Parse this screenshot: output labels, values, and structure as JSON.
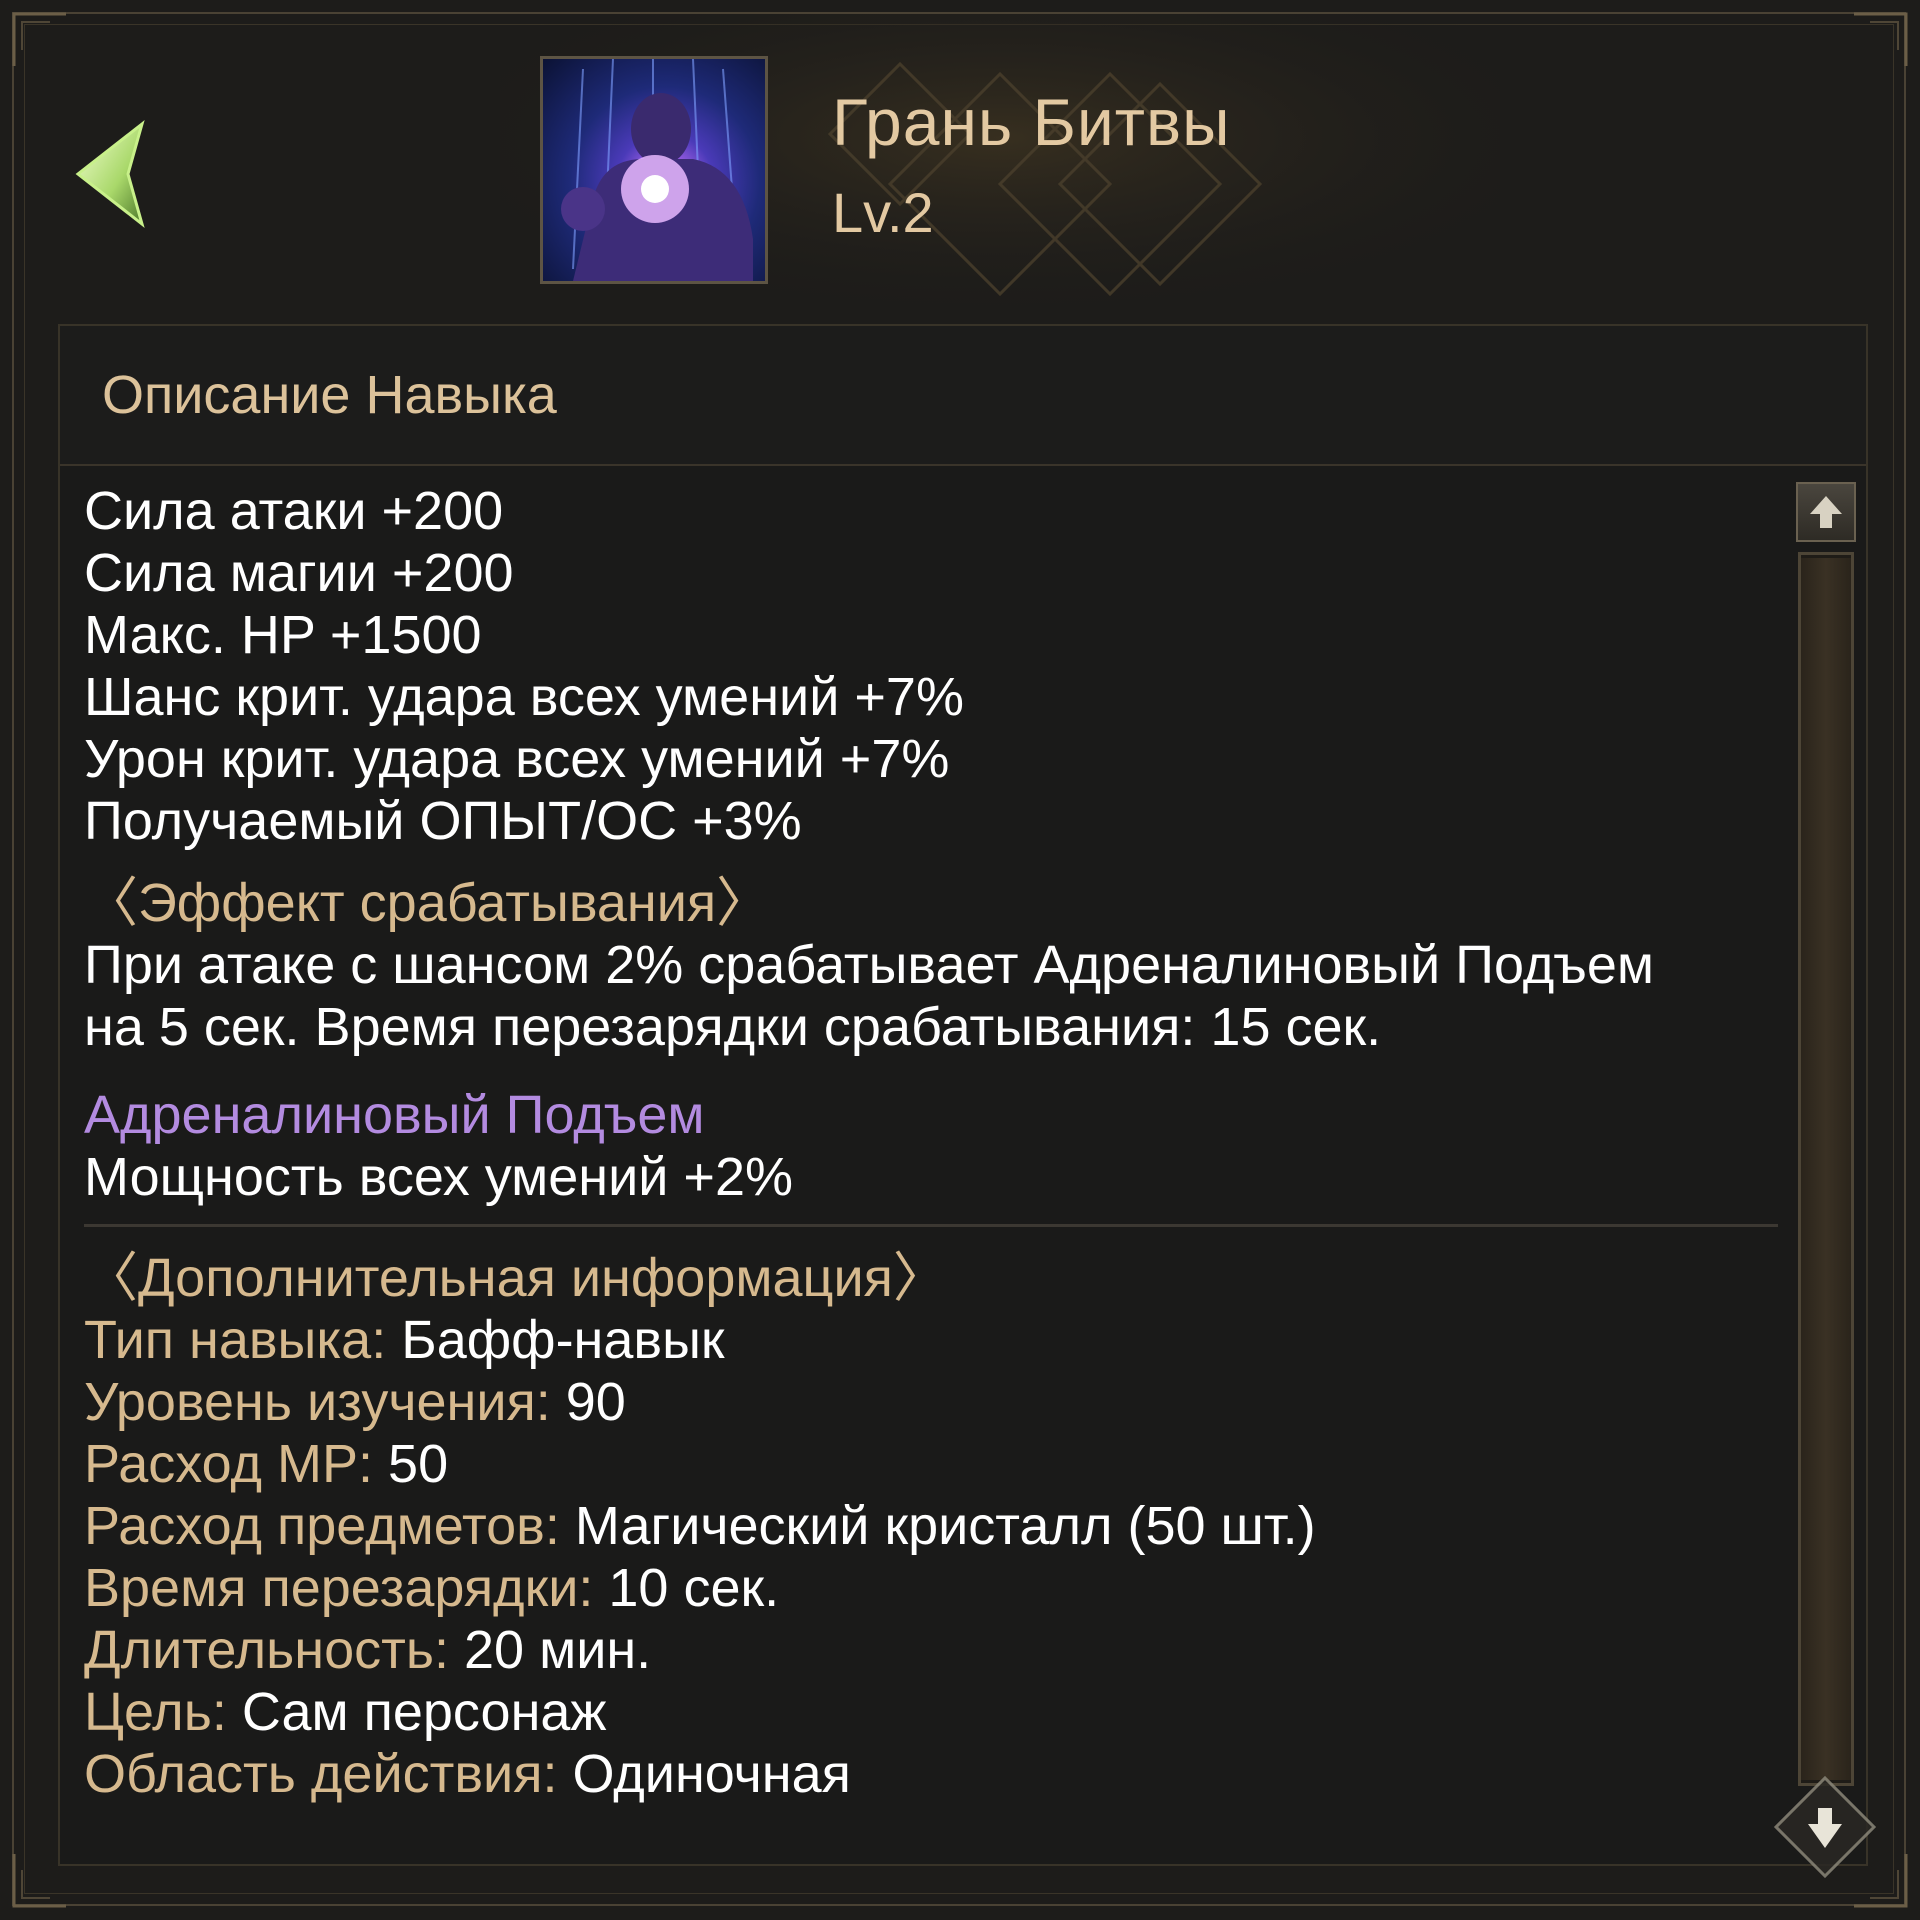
{
  "header": {
    "skill_name": "Грань Битвы",
    "skill_level": "Lv.2",
    "icon": "skill-battle-edge-icon"
  },
  "navigation": {
    "back_icon": "back-arrow-icon"
  },
  "panel": {
    "title": "Описание Навыка"
  },
  "stats": [
    "Сила атаки +200",
    "Сила магии +200",
    "Макс. HP +1500",
    "Шанс крит. удара всех умений +7%",
    "Урон крит. удара всех умений +7%",
    "Получаемый ОПЫТ/ОС +3%"
  ],
  "trigger_effect": {
    "heading": "〈Эффект срабатывания〉",
    "lines": [
      "При атаке с шансом 2% срабатывает Адреналиновый Подъем",
      "на 5 сек. Время перезарядки срабатывания: 15 сек."
    ]
  },
  "buff": {
    "name": "Адреналиновый Подъем",
    "effect": "Мощность всех умений +2%"
  },
  "additional_info": {
    "heading": "〈Дополнительная информация〉",
    "rows": [
      {
        "label": "Тип навыка:",
        "value": "Бафф-навык"
      },
      {
        "label": "Уровень изучения:",
        "value": "90"
      },
      {
        "label": "Расход MP:",
        "value": "50"
      },
      {
        "label": "Расход предметов:",
        "value": "Магический кристалл (50 шт.)"
      },
      {
        "label": "Время перезарядки:",
        "value": "10 сек."
      },
      {
        "label": "Длительность:",
        "value": "20 мин."
      },
      {
        "label": "Цель:",
        "value": "Сам персонаж"
      },
      {
        "label": "Область действия:",
        "value": "Одиночная"
      }
    ]
  },
  "colors": {
    "accent_gold": "#d6b98e",
    "buff_purple": "#b38be0",
    "text_white": "#ffffff",
    "arrow_green": "#b8e07a"
  }
}
